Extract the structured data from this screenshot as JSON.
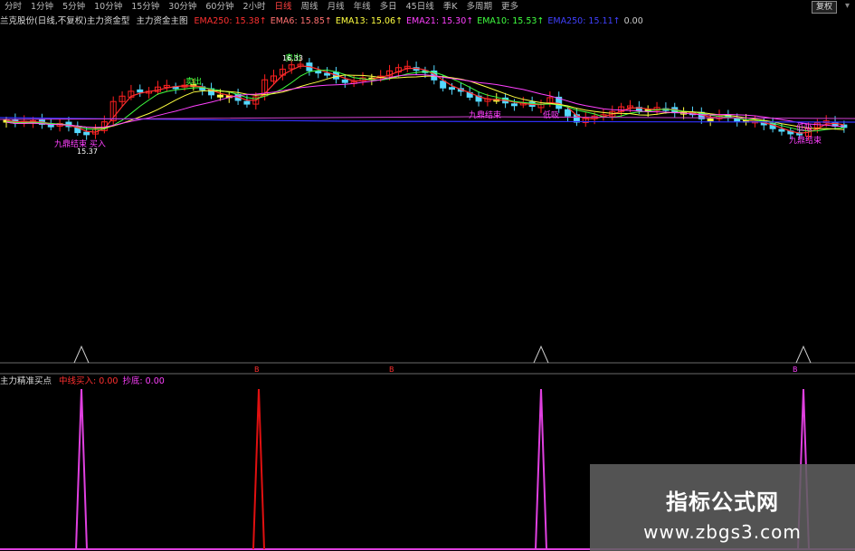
{
  "toolbar": {
    "timeframes": [
      "分时",
      "1分钟",
      "5分钟",
      "10分钟",
      "15分钟",
      "30分钟",
      "60分钟",
      "2小时",
      "日线",
      "周线",
      "月线",
      "年线",
      "多日",
      "45日线",
      "季K",
      "多周期",
      "更多"
    ],
    "active_index": 8,
    "right_button": "复权",
    "right_mark": "▾"
  },
  "upper_legend": {
    "prefix": "兰克股份(日线,不复权)主力资金型",
    "indicator_name": "主力资金主图",
    "items": [
      {
        "label": "EMA250: 15.38↑",
        "color": "#ff3030"
      },
      {
        "label": "EMA6: 15.85↑",
        "color": "#ff7070"
      },
      {
        "label": "EMA13: 15.06↑",
        "color": "#ffff40"
      },
      {
        "label": "EMA21: 15.30↑",
        "color": "#ff40ff"
      },
      {
        "label": "EMA10: 15.53↑",
        "color": "#40ff40"
      },
      {
        "label": "EMA250: 15.11↑",
        "color": "#4040ff"
      },
      {
        "label": "0.00",
        "color": "#cccccc"
      }
    ]
  },
  "lower_legend": {
    "name": "主力精准买点",
    "items": [
      {
        "label": "中线买入: 0.00",
        "color": "#ff3030"
      },
      {
        "label": "抄底: 0.00",
        "color": "#ff40ff"
      }
    ]
  },
  "annotations": {
    "sell": "卖出",
    "sell2": "卖出",
    "price_low": "15.37",
    "price_high": "16.33",
    "lowest_label": "九鼎结束",
    "mid_label1": "九鼎结束",
    "mid_label2": "低吸",
    "right_label1": "九鼎结束",
    "right_label2": "低吸",
    "left_label": "九鼎结束 买入"
  },
  "markers": {
    "m1": "B",
    "m2": "B",
    "m3": "B"
  },
  "watermark": {
    "line1": "指标公式网",
    "line2": "www.zbgs3.com"
  },
  "colors": {
    "up": "#ff2020",
    "down": "#54d8ff",
    "flat": "#ffff40",
    "ma_red": "#ff3030",
    "ma_green": "#40ff40",
    "ma_yellow": "#ffff40",
    "ma_magenta": "#ff40ff",
    "ma_blue": "#3030ff",
    "spike_magenta": "#e040e0",
    "spike_red": "#e01010"
  }
}
